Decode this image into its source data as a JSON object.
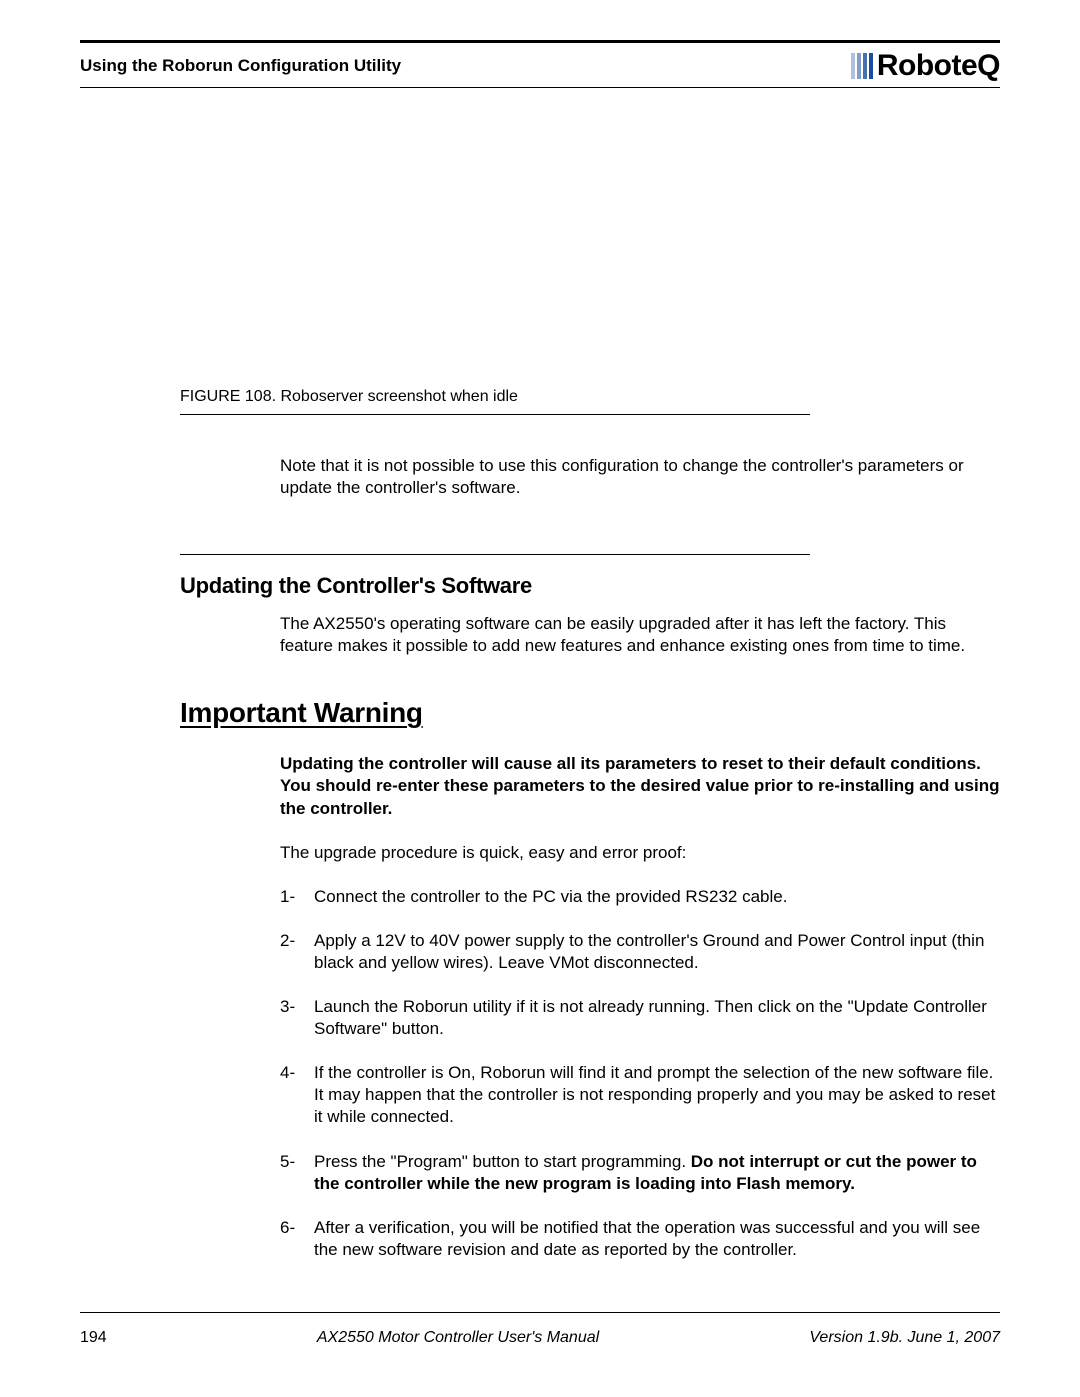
{
  "header": {
    "section": "Using the Roborun Configuration Utility",
    "logo_text": "RoboteQ"
  },
  "figure": {
    "caption": "FIGURE 108.  Roboserver screenshot when idle"
  },
  "note_para": "Note that it is not possible to use this configuration to change the controller's parameters or update the controller's software.",
  "section_heading": "Updating the Controller's Software",
  "section_para": "The AX2550's operating software can be easily upgraded after it has left the factory. This feature makes it possible to add new features and enhance existing ones from time to time.",
  "warning_heading": "Important Warning",
  "warning_bold": "Updating the controller will cause all its parameters to reset to their default conditions. You should re-enter these parameters to the desired value prior to re-installing and using the controller.",
  "procedure_intro": "The upgrade procedure is quick, easy and error proof:",
  "steps": [
    {
      "num": "1-",
      "text": "Connect the controller to the PC via the provided RS232 cable."
    },
    {
      "num": "2-",
      "text": "Apply a 12V to 40V power supply to the controller's Ground and Power Control input (thin black and yellow wires). Leave VMot disconnected."
    },
    {
      "num": "3-",
      "text": "Launch the Roborun utility if it is not already running. Then click on the \"Update Controller Software\" button."
    },
    {
      "num": "4-",
      "text": "If the controller is On, Roborun will find it and prompt the selection of the new software file. It may happen that the controller is not responding properly and you may be asked to reset it while connected."
    },
    {
      "num": "5-",
      "text_a": "Press the \"Program\" button to start programming. ",
      "text_b": "Do not interrupt or cut the power to the controller while the new program is loading into Flash memory."
    },
    {
      "num": "6-",
      "text": "After a verification, you will be notified that the operation was successful and you will see the new software revision and date as reported by the controller."
    }
  ],
  "footer": {
    "page": "194",
    "manual": "AX2550 Motor Controller User's Manual",
    "version": "Version 1.9b. June 1, 2007"
  }
}
